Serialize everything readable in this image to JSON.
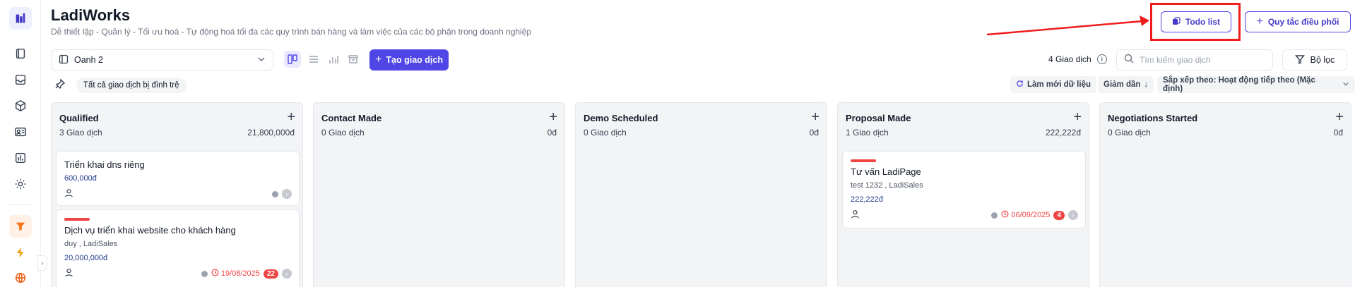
{
  "app": {
    "title": "LadiWorks",
    "subtitle": "Dễ thiết lập - Quản lý - Tối ưu hoá - Tự động hoá tối đa các quy trình bán hàng và làm việc của các bộ phận trong doanh nghiệp"
  },
  "sidebar": {
    "icons": [
      "building-logo-icon",
      "book-icon",
      "inbox-icon",
      "box-icon",
      "contact-card-icon",
      "bar-chart-icon",
      "gear-icon",
      "funnel-icon",
      "lightning-icon",
      "globe-icon"
    ],
    "active": "funnel-icon"
  },
  "header": {
    "todo_label": "Todo list",
    "rules_label": "Quy tắc điều phối",
    "accent": "#4f46e5",
    "highlight_color": "#ef1c1c"
  },
  "toolbar": {
    "pipeline_value": "Oanh 2",
    "create_label": "Tạo giao dịch",
    "deal_count": "4 Giao dịch",
    "search_placeholder": "Tìm kiếm giao dịch",
    "filter_label": "Bộ lọc",
    "views": [
      "kanban",
      "list",
      "report",
      "archive"
    ]
  },
  "subbar": {
    "stalled_chip": "Tất cả giao dịch bị đình trệ",
    "refresh_label": "Làm mới dữ liệu",
    "order_label": "Giảm dần",
    "sort_label": "Sắp xếp theo: Hoạt động tiếp theo (Mặc định)"
  },
  "columns": [
    {
      "name": "Qualified",
      "count": "3 Giao dịch",
      "total": "21,800,000đ",
      "cards": [
        {
          "name": "Triển khai dns riêng",
          "sub": "",
          "amount": "600,000đ",
          "due": "",
          "badge": "",
          "stripe": false
        },
        {
          "name": "Dịch vụ triển khai website cho khách hàng",
          "sub": "duy , LadiSales",
          "amount": "20,000,000đ",
          "due": "19/08/2025",
          "badge": "22",
          "stripe": true
        }
      ]
    },
    {
      "name": "Contact Made",
      "count": "0 Giao dịch",
      "total": "0đ",
      "cards": []
    },
    {
      "name": "Demo Scheduled",
      "count": "0 Giao dịch",
      "total": "0đ",
      "cards": []
    },
    {
      "name": "Proposal Made",
      "count": "1 Giao dịch",
      "total": "222,222đ",
      "cards": [
        {
          "name": "Tư vấn LadiPage",
          "sub": "test 1232 , LadiSales",
          "amount": "222,222đ",
          "due": "06/09/2025",
          "badge": "4",
          "stripe": true
        }
      ]
    },
    {
      "name": "Negotiations Started",
      "count": "0 Giao dịch",
      "total": "0đ",
      "cards": []
    }
  ]
}
